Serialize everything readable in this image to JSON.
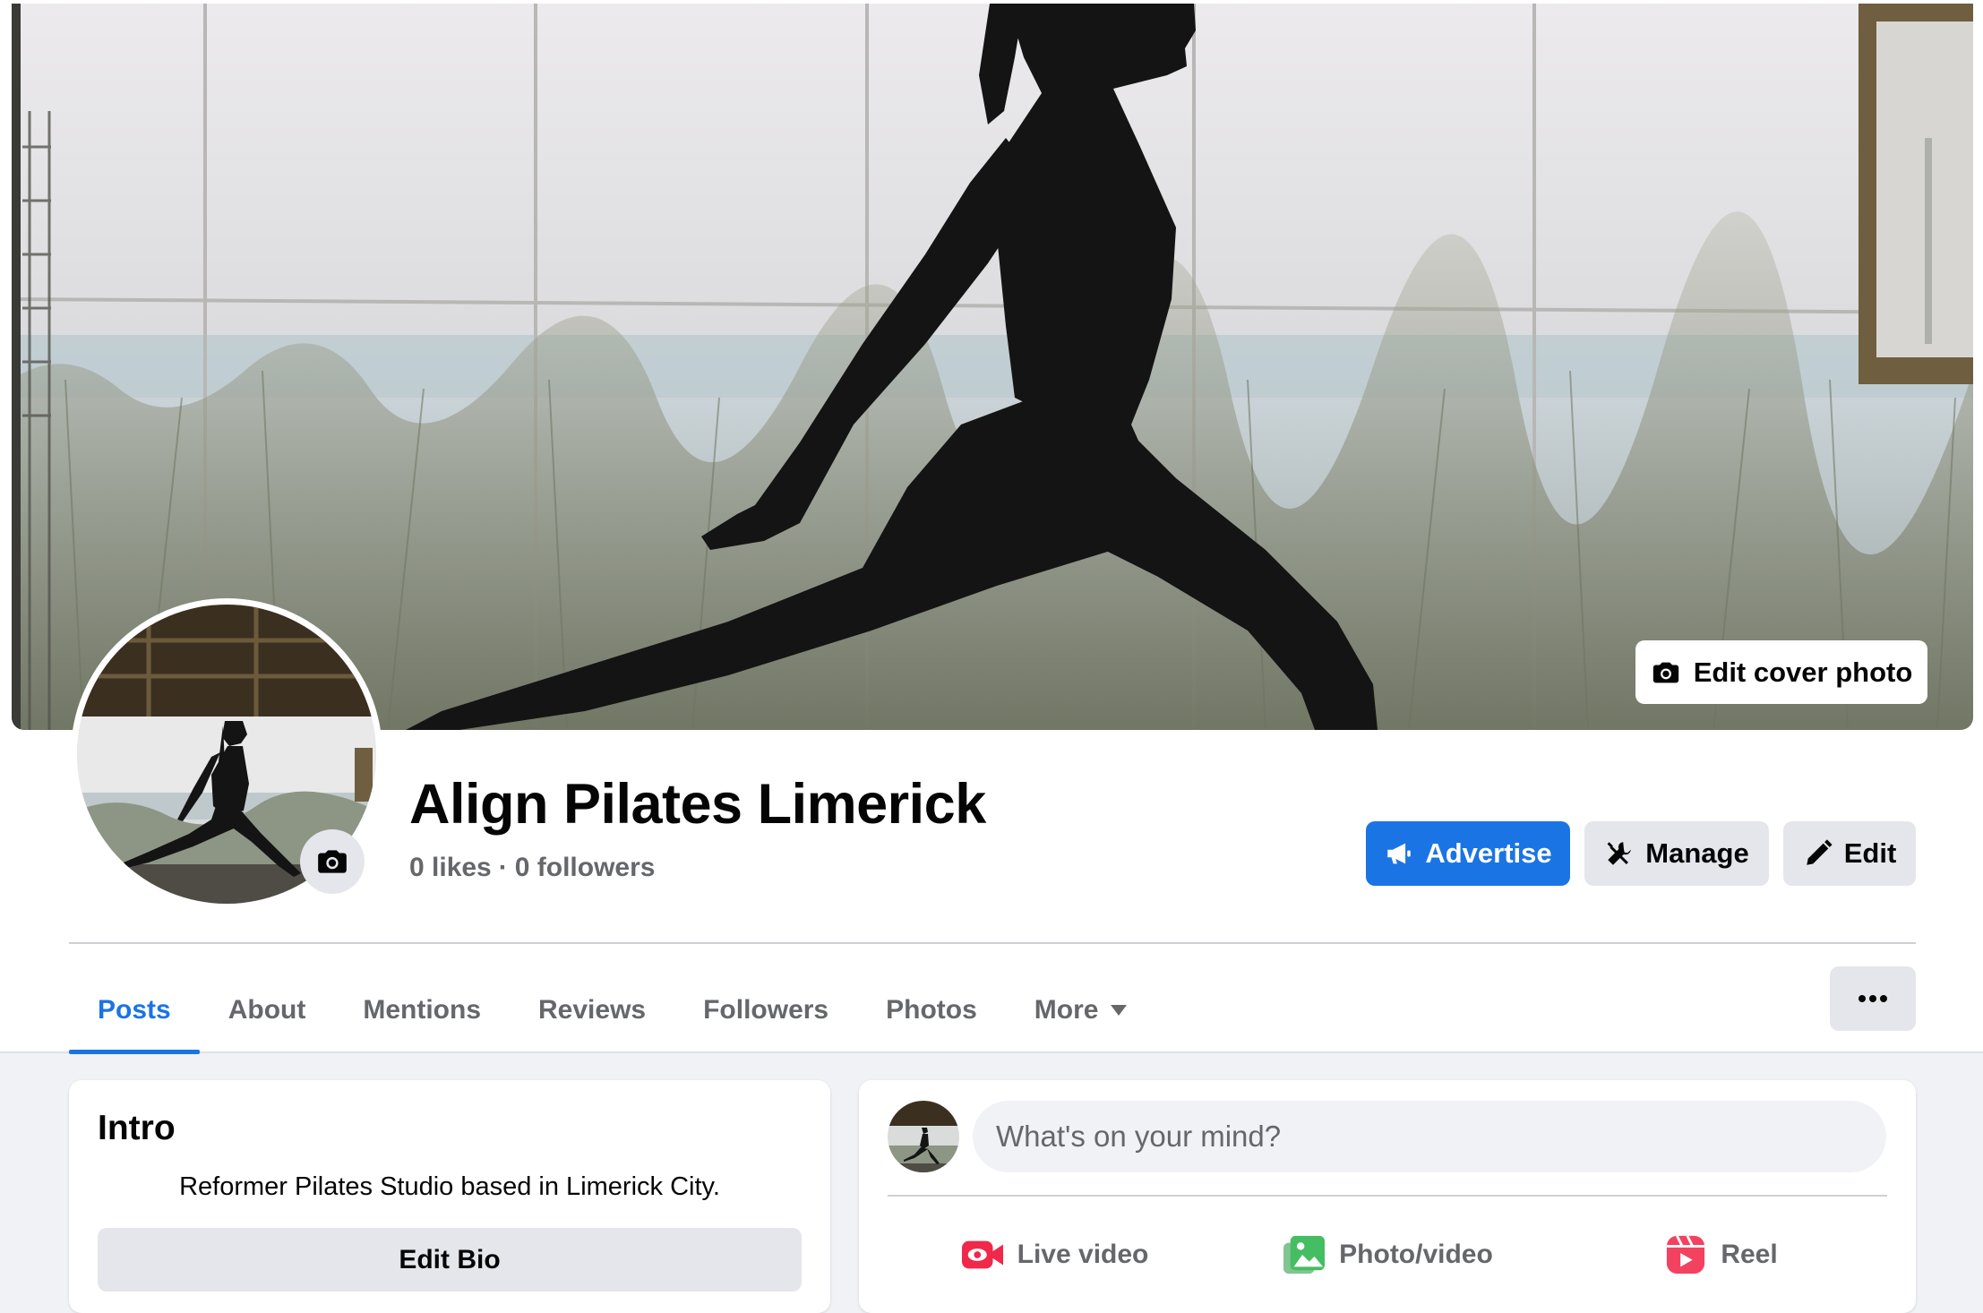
{
  "cover": {
    "edit_cover_label": "Edit cover photo"
  },
  "page": {
    "name": "Align Pilates Limerick",
    "likes": "0 likes",
    "separator": "·",
    "followers": "0 followers"
  },
  "actions": {
    "advertise": "Advertise",
    "manage": "Manage",
    "edit": "Edit"
  },
  "tabs": [
    {
      "label": "Posts",
      "active": true
    },
    {
      "label": "About"
    },
    {
      "label": "Mentions"
    },
    {
      "label": "Reviews"
    },
    {
      "label": "Followers"
    },
    {
      "label": "Photos"
    },
    {
      "label": "More"
    }
  ],
  "intro": {
    "title": "Intro",
    "bio": "Reformer Pilates Studio based in Limerick City.",
    "edit_bio_label": "Edit Bio"
  },
  "composer": {
    "placeholder": "What's on your mind?",
    "actions": [
      {
        "label": "Live video",
        "icon": "live-video-icon",
        "color": "#f02849"
      },
      {
        "label": "Photo/video",
        "icon": "photo-video-icon",
        "color": "#45bd62"
      },
      {
        "label": "Reel",
        "icon": "reel-icon",
        "color": "#f3425f"
      }
    ]
  },
  "colors": {
    "accent": "#1b74e4",
    "secondary_text": "#65676b",
    "button_gray": "#e4e6eb"
  }
}
